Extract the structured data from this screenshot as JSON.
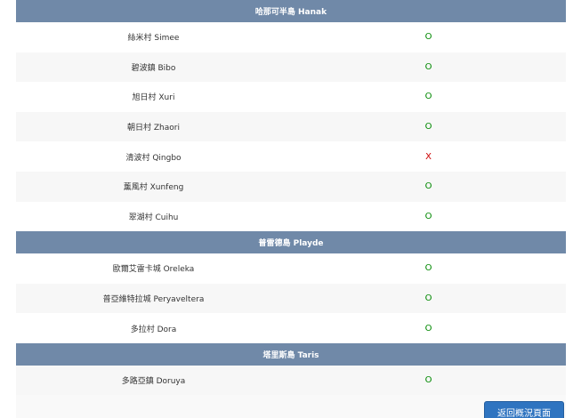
{
  "sections": [
    {
      "title": "哈那可半島 Hanak",
      "rows": [
        {
          "name": "絲米村 Simee",
          "mark": "O",
          "status": "ok"
        },
        {
          "name": "碧波鎮 Bibo",
          "mark": "O",
          "status": "ok"
        },
        {
          "name": "旭日村 Xuri",
          "mark": "O",
          "status": "ok"
        },
        {
          "name": "朝日村 Zhaori",
          "mark": "O",
          "status": "ok"
        },
        {
          "name": "清波村 Qingbo",
          "mark": "X",
          "status": "ng"
        },
        {
          "name": "薰風村 Xunfeng",
          "mark": "O",
          "status": "ok"
        },
        {
          "name": "翠湖村 Cuihu",
          "mark": "O",
          "status": "ok"
        }
      ]
    },
    {
      "title": "普雷德島 Playde",
      "rows": [
        {
          "name": "歐爾艾雷卡城 Oreleka",
          "mark": "O",
          "status": "ok"
        },
        {
          "name": "普亞維特拉城 Peryaveltera",
          "mark": "O",
          "status": "ok"
        },
        {
          "name": "多拉村 Dora",
          "mark": "O",
          "status": "ok"
        }
      ]
    },
    {
      "title": "塔里斯島 Taris",
      "rows": [
        {
          "name": "多路亞鎮 Doruya",
          "mark": "O",
          "status": "ok"
        }
      ]
    }
  ],
  "back_button": {
    "label": "返回概況頁面"
  },
  "colors": {
    "header": "#7089a8",
    "ok": "#008800",
    "ng": "#cc0000",
    "button": "#2f74c0"
  }
}
